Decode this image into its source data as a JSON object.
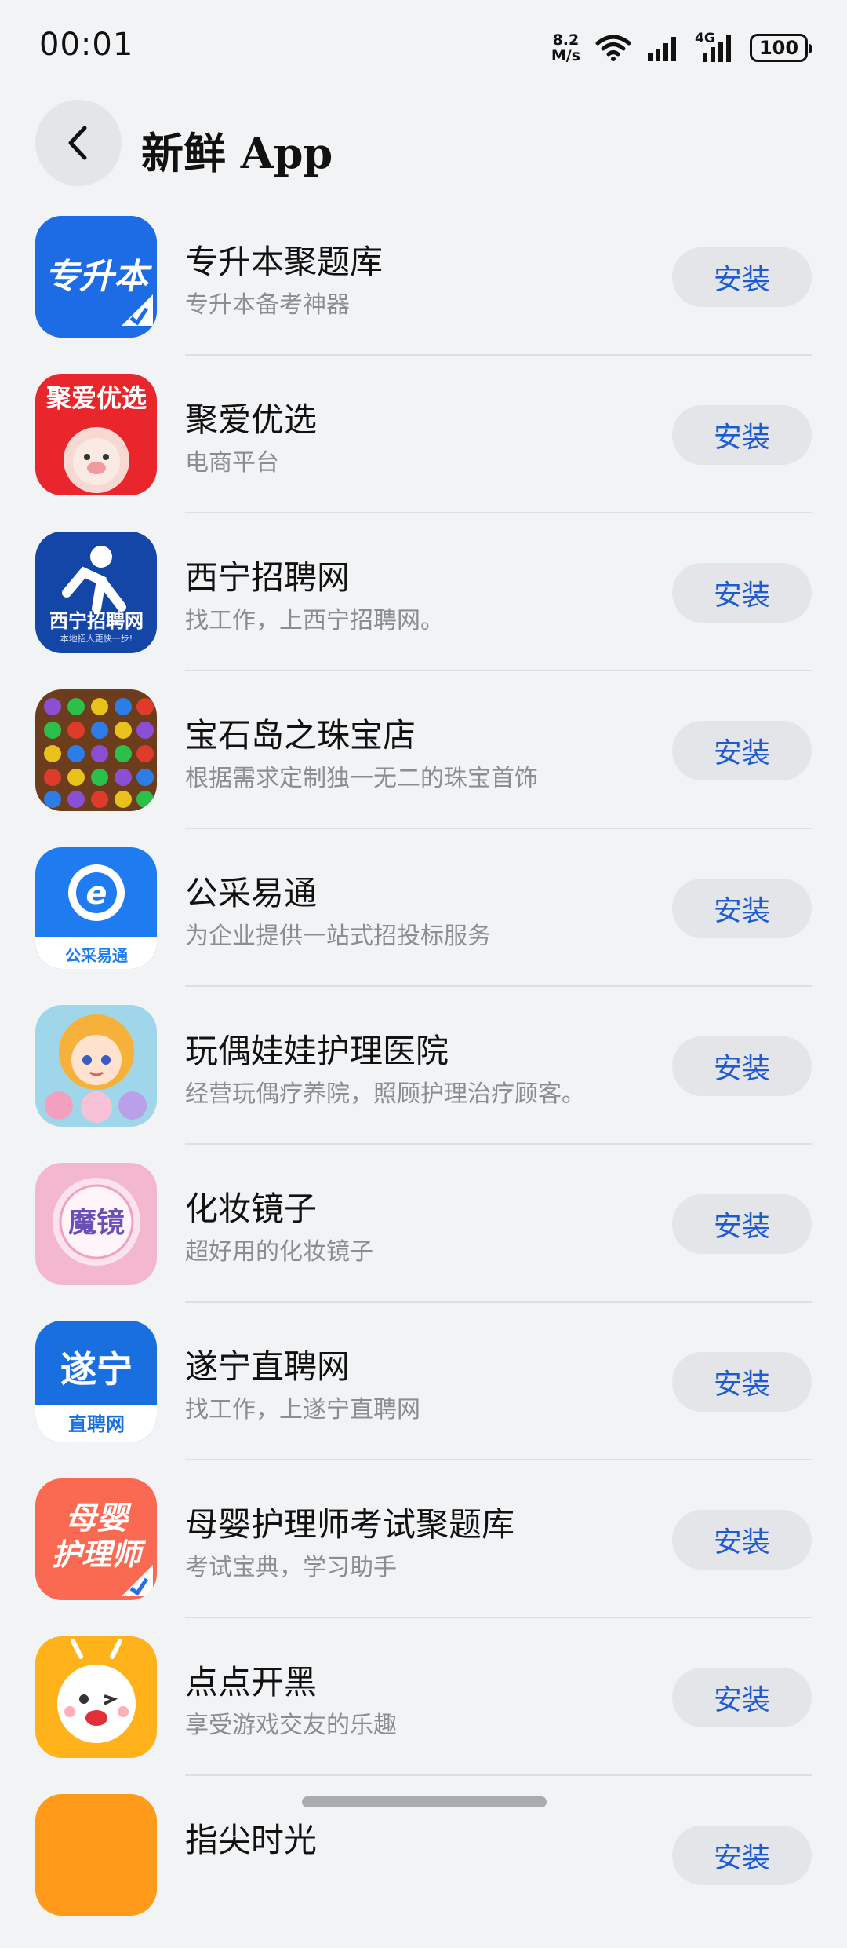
{
  "status_bar": {
    "time": "00:01",
    "net_speed_value": "8.2",
    "net_speed_unit": "M/s",
    "network_type": "4G",
    "battery": "100",
    "icons": [
      "wifi-icon",
      "signal-icon",
      "4g-signal-icon",
      "battery-icon"
    ]
  },
  "header": {
    "title": "新鲜 App",
    "back_icon": "chevron-left-icon"
  },
  "apps": [
    {
      "name": "专升本聚题库",
      "desc": "专升本备考神器",
      "action": "安装",
      "icon_text": "专升本",
      "icon_color": "#1e6be6"
    },
    {
      "name": "聚爱优选",
      "desc": "电商平台",
      "action": "安装",
      "icon_text": "聚爱优选",
      "icon_color": "#e8262c"
    },
    {
      "name": "西宁招聘网",
      "desc": "找工作，上西宁招聘网。",
      "action": "安装",
      "icon_text": "西宁招聘网",
      "icon_subtext": "本地招人更快一步!",
      "icon_color": "#1446a8"
    },
    {
      "name": "宝石岛之珠宝店",
      "desc": "根据需求定制独一无二的珠宝首饰",
      "action": "安装",
      "icon_color": "#6b3d1d"
    },
    {
      "name": "公采易通",
      "desc": "为企业提供一站式招投标服务",
      "action": "安装",
      "icon_text": "公采易通",
      "icon_color": "#1f7bf0"
    },
    {
      "name": "玩偶娃娃护理医院",
      "desc": "经营玩偶疗养院，照顾护理治疗顾客。",
      "action": "安装",
      "icon_color": "#9fd6ea"
    },
    {
      "name": "化妆镜子",
      "desc": "超好用的化妆镜子",
      "action": "安装",
      "icon_text": "魔镜",
      "icon_color": "#f3b8cf"
    },
    {
      "name": "遂宁直聘网",
      "desc": "找工作，上遂宁直聘网",
      "action": "安装",
      "icon_text": "遂宁",
      "icon_subtext": "直聘网",
      "icon_color": "#1a6fe0"
    },
    {
      "name": "母婴护理师考试聚题库",
      "desc": "考试宝典，学习助手",
      "action": "安装",
      "icon_text": "母婴",
      "icon_subtext": "护理师",
      "icon_color": "#fa6a52"
    },
    {
      "name": "点点开黑",
      "desc": "享受游戏交友的乐趣",
      "action": "安装",
      "icon_color": "#ffb21a"
    },
    {
      "name": "指尖时光",
      "desc": "",
      "action": "安装",
      "icon_color": "#ff9a1a"
    }
  ]
}
